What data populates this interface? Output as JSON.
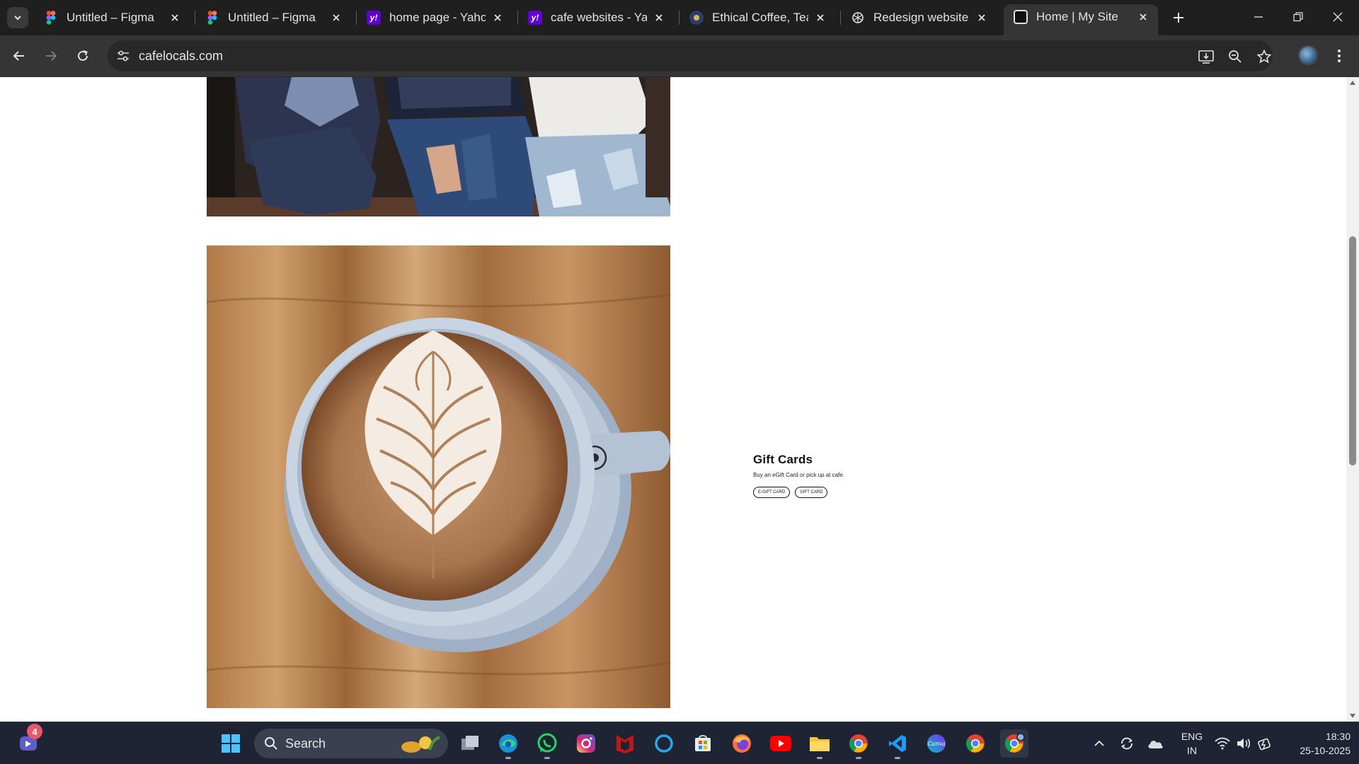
{
  "browser": {
    "tabs": [
      {
        "title": "Untitled – Figma",
        "favicon": "figma-icon"
      },
      {
        "title": "Untitled – Figma",
        "favicon": "figma-icon"
      },
      {
        "title": "home page - Yahoo Search Results",
        "favicon": "yahoo-icon"
      },
      {
        "title": "cafe websites - Yahoo Search Results",
        "favicon": "yahoo-icon"
      },
      {
        "title": "Ethical Coffee, Tea & More",
        "favicon": "ethical-coffee-icon"
      },
      {
        "title": "Redesign website homepage",
        "favicon": "chatgpt-icon"
      },
      {
        "title": "Home | My Site",
        "favicon": "wix-site-icon",
        "active": true
      }
    ],
    "url": "cafelocals.com"
  },
  "page": {
    "gift_cards": {
      "title": "Gift Cards",
      "description": "Buy an eGift Card or pick up at cafe.",
      "buttons": [
        "E-GIFT CARD",
        "GIFT CARD"
      ]
    }
  },
  "taskbar": {
    "search_label": "Search",
    "notification_count": "4",
    "language_line1": "ENG",
    "language_line2": "IN",
    "time": "18:30",
    "date": "25-10-2025",
    "apps": [
      "teams-icon",
      "windows-start-icon",
      "search-icon",
      "task-view-icon",
      "edge-icon",
      "whatsapp-icon",
      "instagram-icon",
      "mcafee-icon",
      "cortana-icon",
      "microsoft-store-icon",
      "firefox-icon",
      "youtube-icon",
      "file-explorer-icon",
      "chrome-canary-icon",
      "vscode-icon",
      "canva-icon",
      "chrome-icon",
      "chrome-profile-icon"
    ]
  },
  "colors": {
    "tabstrip_bg": "#1f1f1f",
    "toolbar_bg": "#353535",
    "taskbar_bg": "#1e2433",
    "active_tab_indicator": "#c4a6ff"
  }
}
